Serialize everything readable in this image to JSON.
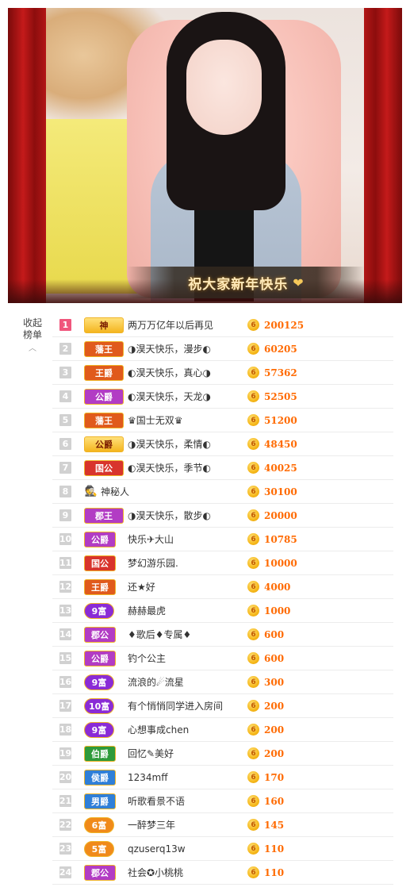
{
  "video": {
    "banner_text": "祝大家新年快乐"
  },
  "collapse": {
    "label_line1": "收起",
    "label_line2": "榜单"
  },
  "ranking": [
    {
      "rank": "1",
      "badge": "神",
      "badge_color": "#f4b51f",
      "name": "两万万亿年以后再见",
      "score": "200125"
    },
    {
      "rank": "2",
      "badge": "藩王",
      "badge_color": "#e05a1c",
      "name": "◑淏天快乐，漫步◐",
      "score": "60205"
    },
    {
      "rank": "3",
      "badge": "王爵",
      "badge_color": "#e05a1c",
      "name": "◐淏天快乐，真心◑",
      "score": "57362"
    },
    {
      "rank": "4",
      "badge": "公爵",
      "badge_color": "#b23cc4",
      "name": "◐淏天快乐，天龙◑",
      "score": "52505"
    },
    {
      "rank": "5",
      "badge": "藩王",
      "badge_color": "#e05a1c",
      "name": "♛国士无双♛",
      "score": "51200"
    },
    {
      "rank": "6",
      "badge": "公爵",
      "badge_color": "#e05a1c",
      "name": "◑淏天快乐，柔情◐",
      "score": "48450"
    },
    {
      "rank": "7",
      "badge": "国公",
      "badge_color": "#d8342c",
      "name": "◐淏天快乐，季节◐",
      "score": "40025"
    },
    {
      "rank": "8",
      "badge": "",
      "badge_color": "",
      "name": "神秘人",
      "score": "30100"
    },
    {
      "rank": "9",
      "badge": "郡王",
      "badge_color": "#b23cc4",
      "name": "◑淏天快乐，散步◐",
      "score": "20000"
    },
    {
      "rank": "10",
      "badge": "公爵",
      "badge_color": "#b23cc4",
      "name": "快乐✈大山",
      "score": "10785"
    },
    {
      "rank": "11",
      "badge": "国公",
      "badge_color": "#d8342c",
      "name": "梦幻游乐园.",
      "score": "10000"
    },
    {
      "rank": "12",
      "badge": "王爵",
      "badge_color": "#e05a1c",
      "name": "还★好",
      "score": "4000"
    },
    {
      "rank": "13",
      "badge": "9富",
      "badge_color": "#8a2bd6",
      "name": "赫赫最虎",
      "score": "1000"
    },
    {
      "rank": "14",
      "badge": "郡公",
      "badge_color": "#b23cc4",
      "name": "♦歌后♦专属♦",
      "score": "600"
    },
    {
      "rank": "15",
      "badge": "公爵",
      "badge_color": "#b23cc4",
      "name": "钓个公主",
      "score": "600"
    },
    {
      "rank": "16",
      "badge": "9富",
      "badge_color": "#8a2bd6",
      "name": "流浪的☄流星",
      "score": "300"
    },
    {
      "rank": "17",
      "badge": "10富",
      "badge_color": "#8a2bd6",
      "name": "有个悄悄同学进入房间",
      "score": "200"
    },
    {
      "rank": "18",
      "badge": "9富",
      "badge_color": "#8a2bd6",
      "name": "心想事成chen",
      "score": "200"
    },
    {
      "rank": "19",
      "badge": "伯爵",
      "badge_color": "#2e9a3a",
      "name": "回忆✎美好",
      "score": "200"
    },
    {
      "rank": "20",
      "badge": "侯爵",
      "badge_color": "#2f7fd8",
      "name": "1234mff",
      "score": "170"
    },
    {
      "rank": "21",
      "badge": "男爵",
      "badge_color": "#2f7fd8",
      "name": "听歌看景不语",
      "score": "160"
    },
    {
      "rank": "22",
      "badge": "6富",
      "badge_color": "#f08a1a",
      "name": "一醉梦三年",
      "score": "145"
    },
    {
      "rank": "23",
      "badge": "5富",
      "badge_color": "#f08a1a",
      "name": "qzuserq13w",
      "score": "110"
    },
    {
      "rank": "24",
      "badge": "郡公",
      "badge_color": "#b23cc4",
      "name": "社会✪小桃桃",
      "score": "110"
    }
  ],
  "coin_glyph": "6"
}
